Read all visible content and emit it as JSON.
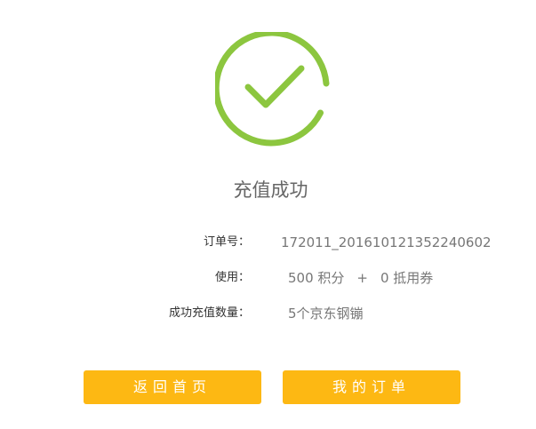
{
  "success": {
    "icon": "check-circle-icon",
    "title": "充值成功",
    "accent_color": "#8cc63f"
  },
  "details": {
    "order_label": "订单号：",
    "order_value": "172011_20161012135224060​2",
    "usage_label": "使用：",
    "usage_points": "500 积分",
    "usage_plus": "+",
    "usage_coupon": "0 抵用券",
    "count_label": "成功充值数量：",
    "count_value": "5个京东钢镚"
  },
  "actions": {
    "home_label": "返回首页",
    "orders_label": "我的订单",
    "button_color": "#fdb813"
  }
}
